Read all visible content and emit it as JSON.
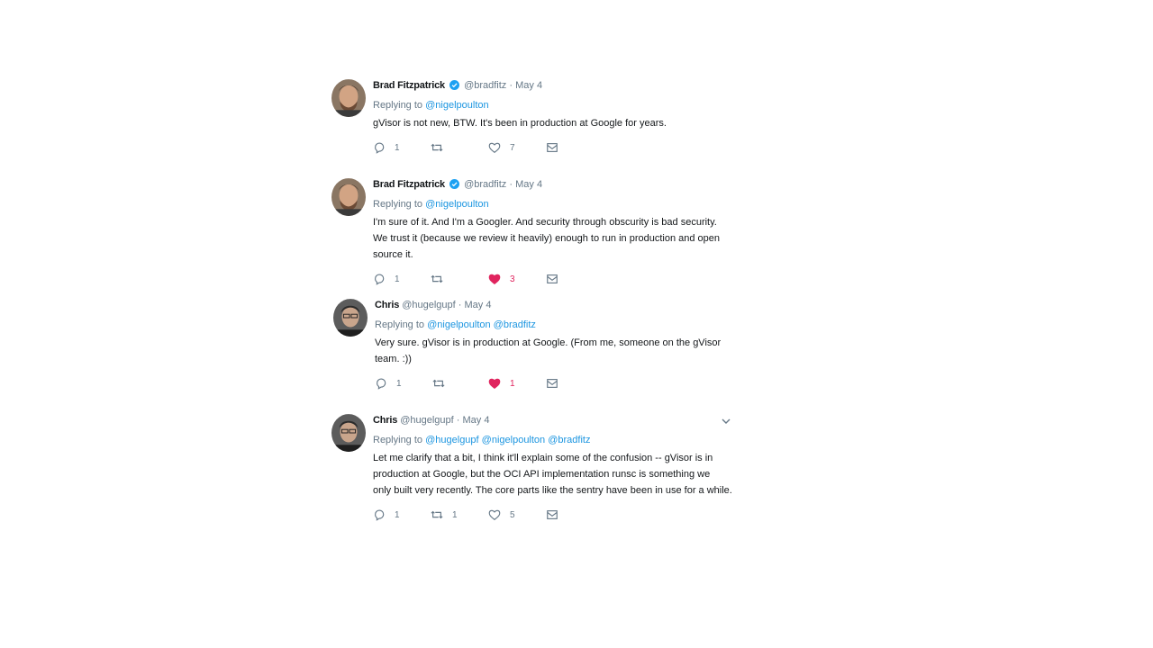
{
  "tweets": [
    {
      "name": "Brad Fitzpatrick",
      "verified": true,
      "handle": "@bradfitz",
      "sep": "·",
      "date": "May 4",
      "replying_prefix": "Replying to",
      "mentions": [
        "@nigelpoulton"
      ],
      "text_lines": [
        "gVisor is not new, BTW. It's been in production at Google for years."
      ],
      "reply_count": "1",
      "retweet_count": "",
      "like_count": "7",
      "liked": false
    },
    {
      "name": "Brad Fitzpatrick",
      "verified": true,
      "handle": "@bradfitz",
      "sep": "·",
      "date": "May 4",
      "replying_prefix": "Replying to",
      "mentions": [
        "@nigelpoulton"
      ],
      "text_lines": [
        "I'm sure of it. And I'm a Googler. And security through obscurity is bad security.",
        "We trust it (because we review it heavily) enough to run in production and open",
        "source it."
      ],
      "reply_count": "1",
      "retweet_count": "",
      "like_count": "3",
      "liked": true
    },
    {
      "name": "Chris",
      "verified": false,
      "handle": "@hugelgupf",
      "sep": "·",
      "date": "May 4",
      "replying_prefix": "Replying to",
      "mentions": [
        "@nigelpoulton",
        "@bradfitz"
      ],
      "text_lines": [
        "Very sure. gVisor is in production at Google. (From me, someone on the gVisor",
        "team. :))"
      ],
      "reply_count": "1",
      "retweet_count": "",
      "like_count": "1",
      "liked": true
    },
    {
      "name": "Chris",
      "verified": false,
      "handle": "@hugelgupf",
      "sep": "·",
      "date": "May 4",
      "replying_prefix": "Replying to",
      "mentions": [
        "@hugelgupf",
        "@nigelpoulton",
        "@bradfitz"
      ],
      "text_lines": [
        "Let me clarify that a bit, I think it'll explain some of the confusion -- gVisor is in",
        "production at Google, but the OCI API implementation runsc is something we",
        "only built very recently. The core parts like the sentry have been in use for a while."
      ],
      "reply_count": "1",
      "retweet_count": "1",
      "like_count": "5",
      "liked": false
    }
  ],
  "icons": {
    "reply": "reply-icon",
    "retweet": "retweet-icon",
    "like": "heart-icon",
    "message": "direct-message-icon",
    "verified": "verified-badge-icon",
    "more": "chevron-down-icon"
  },
  "colors": {
    "text": "#14171a",
    "muted": "#657786",
    "link": "#1b95e0",
    "like_active": "#e0245e",
    "verified": "#1da1f2"
  }
}
